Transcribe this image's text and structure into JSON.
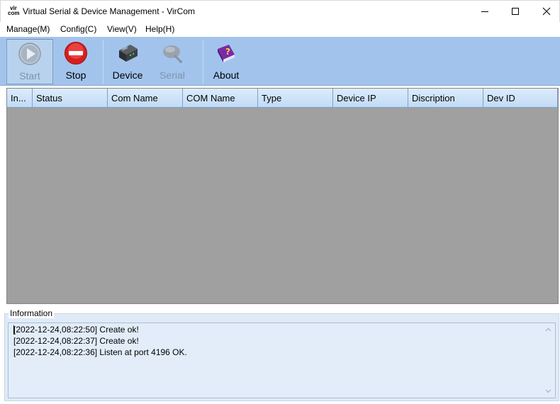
{
  "window": {
    "logo_text": "vir com",
    "title": "Virtual Serial & Device Management - VirCom"
  },
  "menu": [
    {
      "label": "Manage(M)"
    },
    {
      "label": "Config(C)"
    },
    {
      "label": "View(V)"
    },
    {
      "label": "Help(H)"
    }
  ],
  "toolbar": {
    "start": {
      "label": "Start",
      "icon": "play-icon",
      "enabled": false
    },
    "stop": {
      "label": "Stop",
      "icon": "stop-icon",
      "enabled": true
    },
    "device": {
      "label": "Device",
      "icon": "device-icon",
      "enabled": true
    },
    "serial": {
      "label": "Serial",
      "icon": "serial-icon",
      "enabled": false
    },
    "about": {
      "label": "About",
      "icon": "about-book-icon",
      "enabled": true
    }
  },
  "table": {
    "columns": [
      "In...",
      "Status",
      "Com Name",
      "COM Name",
      "Type",
      "Device IP",
      "Discription",
      "Dev ID"
    ],
    "rows": []
  },
  "info": {
    "legend": "Information",
    "lines": [
      "[2022-12-24,08:22:50] Create ok!",
      "[2022-12-24,08:22:37] Create ok!",
      "[2022-12-24,08:22:36] Listen at port 4196 OK."
    ]
  },
  "colors": {
    "toolbar_bg": "#a2c4ec",
    "list_bg": "#a0a0a0",
    "header_bg": "#c9e0f8",
    "info_bg": "#e2edf9"
  }
}
